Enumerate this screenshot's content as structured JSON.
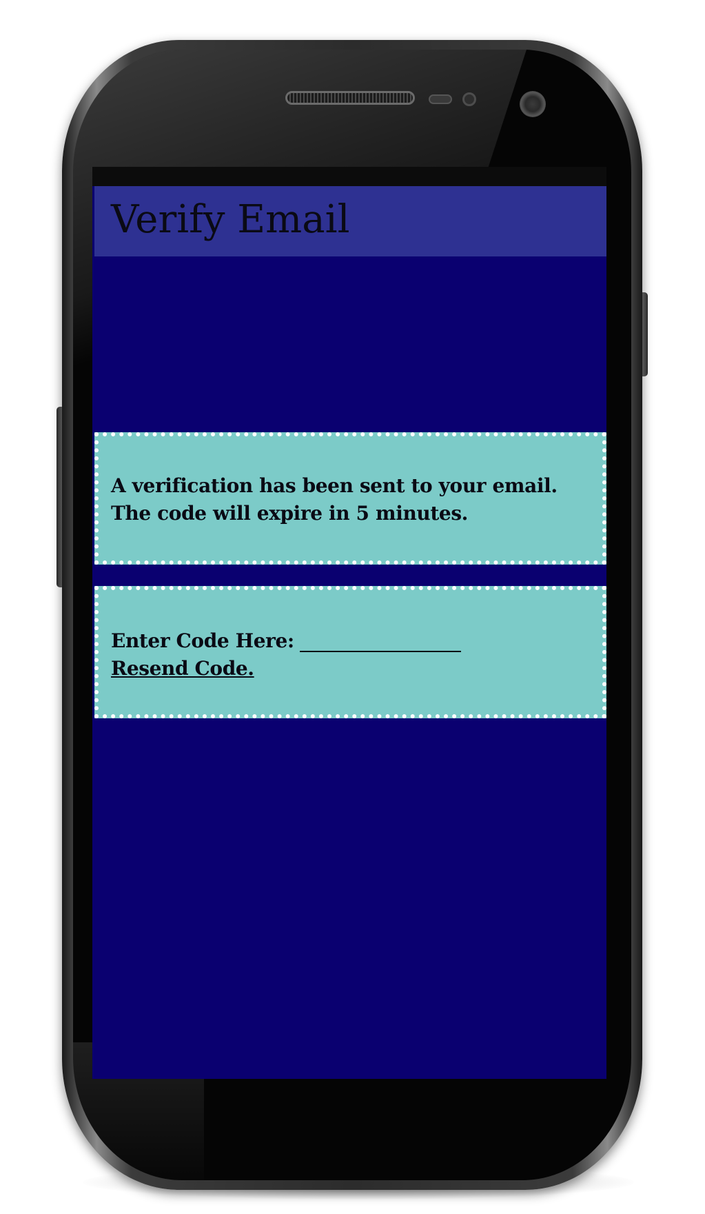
{
  "app_bar": {
    "title": "Verify Email"
  },
  "info_card": {
    "line1": "A verification has been sent to your email.",
    "line2": "The code will expire in 5 minutes."
  },
  "code_card": {
    "label": "Enter Code Here:",
    "input_value": "",
    "resend_label": "Resend Code."
  },
  "colors": {
    "screen_background": "#0a0070",
    "app_bar_background": "#2e3192",
    "card_background": "#7ccbc8",
    "card_border": "#ffffff",
    "text": "#0a0a14"
  }
}
